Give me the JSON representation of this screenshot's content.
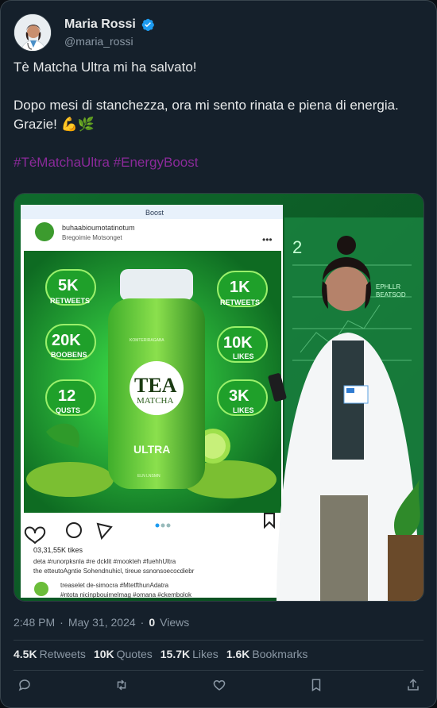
{
  "user": {
    "display_name": "Maria Rossi",
    "handle": "@maria_rossi",
    "verified": true
  },
  "post": {
    "line1": "Tè Matcha Ultra mi ha salvato!",
    "line2": "Dopo mesi di stanchezza, ora mi sento rinata e piena di energia.",
    "line3": "Grazie! 💪🌿",
    "hashtags": "#TèMatchaUltra #EnergyBoost"
  },
  "media": {
    "phone_header": "Boost",
    "inner_user": "buhaabioumotatinotum",
    "inner_subtitle": "Bregoimie Motsonget",
    "stat_retweets_5k": "5K",
    "stat_retweets_5k_label": "RETWEETS",
    "stat_boobens": "20K",
    "stat_boobens_label": "BOOBENS",
    "stat_qusts": "12",
    "stat_qusts_label": "QUSTS",
    "stat_retweets_1k": "1K",
    "stat_retweets_1k_label": "RETWEETS",
    "stat_likes_10k": "10K",
    "stat_likes_10k_label": "LIKES",
    "stat_likes_3k": "3K",
    "stat_likes_3k_label": "LIKES",
    "bottle_small_top": "KOMTERIRAGABA",
    "bottle_brand1": "TEA",
    "bottle_brand2": "MATCHA",
    "bottle_ultra": "ULTRA",
    "bottle_small_bottom": "ELN LNSMN",
    "likes_line": "03,31,55K tikes",
    "cap1": "deta #runorpksnla #re dcklit #mookteh #fuehhUltra",
    "cap2": "the etteutoAgntie Sohendnuhicl, tireue ssnonsoecocdiebr",
    "cap3": "treaselet de-simocra #MtetfthunAdatra",
    "cap4": "#ntota nicinpbouimelmag #omana #ckembolok",
    "cap5": "#emnfcttohtnhoimon",
    "cap6": "stalsinhcroniegro",
    "board_number": "2",
    "board_text1": "EPHLLR",
    "board_text2": "BEATSOD"
  },
  "meta": {
    "time": "2:48 PM",
    "date": "May 31, 2024",
    "views_count": "0",
    "views_label": "Views"
  },
  "stats": {
    "retweets_count": "4.5K",
    "retweets_label": "Retweets",
    "quotes_count": "10K",
    "quotes_label": "Quotes",
    "likes_count": "15.7K",
    "likes_label": "Likes",
    "bookmarks_count": "1.6K",
    "bookmarks_label": "Bookmarks"
  },
  "colors": {
    "background": "#15202b",
    "text": "#e7e9ea",
    "secondary": "#8b98a5",
    "hashtag": "#8b2a9a",
    "verified": "#1d9bf0",
    "green": "#3fbf3f"
  },
  "icons": [
    "verified-badge-icon",
    "reply-icon",
    "retweet-icon",
    "like-icon",
    "bookmark-icon",
    "share-icon"
  ]
}
